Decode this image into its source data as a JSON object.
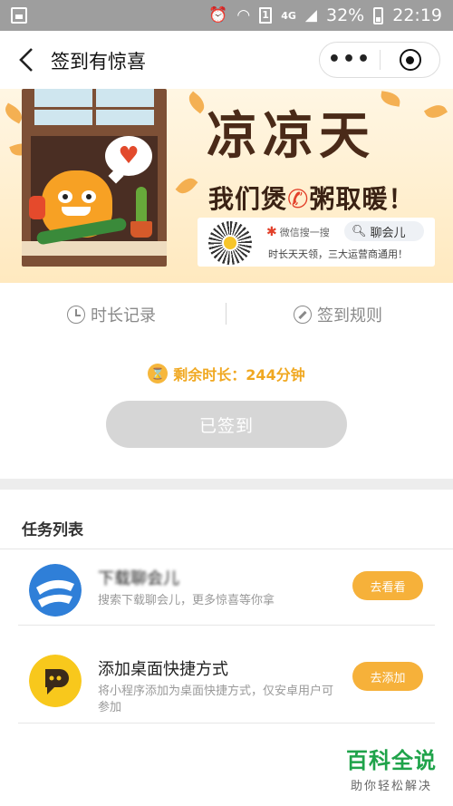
{
  "status_bar": {
    "icons": [
      "image-icon",
      "alarm-icon",
      "wifi-icon",
      "sim-1-icon",
      "network-4g-icon",
      "signal-icon",
      "battery-icon"
    ],
    "sim_label": "1",
    "network": "4G",
    "battery": "32%",
    "time": "22:19"
  },
  "nav": {
    "title": "签到有惊喜",
    "more_label": "•••"
  },
  "banner": {
    "title": "凉凉天",
    "slogan_pre": "我们煲",
    "slogan_post": "粥取暖！",
    "wechat_search": "微信搜一搜",
    "search_query": "聊会儿",
    "note": "时长天天领，三大运营商通用！",
    "heart": "♥"
  },
  "tabs": {
    "history": "时长记录",
    "rules": "签到规则"
  },
  "remaining": {
    "label": "剩余时长：244分钟"
  },
  "sign_button": "已签到",
  "tasks": {
    "title": "任务列表",
    "items": [
      {
        "name": "下载聊会儿",
        "desc": "搜索下载聊会儿，更多惊喜等你拿",
        "button": "去看看"
      },
      {
        "name": "添加桌面快捷方式",
        "desc": "将小程序添加为桌面快捷方式，仅安卓用户可参加",
        "button": "去添加"
      }
    ]
  },
  "watermark": {
    "title": "百科全说",
    "subtitle": "助你轻松解决"
  },
  "colors": {
    "accent_orange": "#f6b13a",
    "status_bar": "#9e9e9e",
    "disabled_button": "#d6d6d6",
    "watermark_green": "#1fa34a"
  }
}
